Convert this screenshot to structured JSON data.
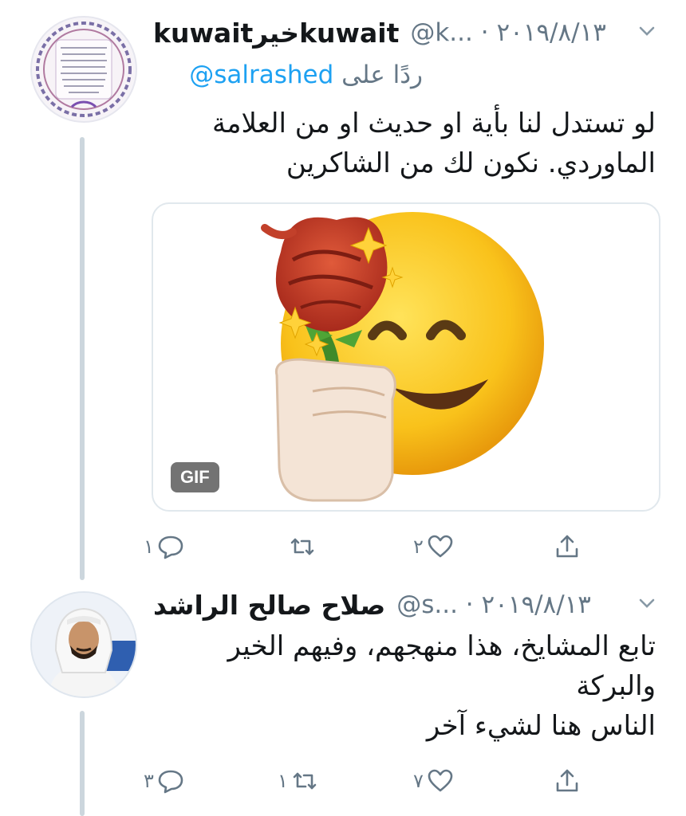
{
  "tweet1": {
    "author_name": "kuwaitخيرkuwait",
    "meta": "@k... · ٢٠١٩/٨/١٣",
    "reply_to_label": "ردًا على",
    "reply_to_handle": "@salrashed",
    "text_lines": [
      "لو تستدل لنا بأية او حديث او من العلامة",
      "الماوردي. نكون لك من الشاكرين"
    ],
    "media_badge": "GIF",
    "actions": {
      "reply_count": "١",
      "retweet_count": "",
      "like_count": "٢"
    }
  },
  "tweet2": {
    "author_name": "صلاح صالح الراشد",
    "meta": "@s... · ٢٠١٩/٨/١٣",
    "text_lines": [
      "تابع المشايخ، هذا منهجهم، وفيهم الخير",
      "والبركة",
      "الناس هنا لشيء آخر"
    ],
    "actions": {
      "reply_count": "٣",
      "retweet_count": "١",
      "like_count": "٧"
    }
  },
  "icons": {
    "reply": "speech-bubble-icon",
    "retweet": "retweet-arrows-icon",
    "like": "heart-icon",
    "share": "share-upload-icon",
    "caret": "chevron-down-icon"
  },
  "colors": {
    "text": "#14171a",
    "secondary": "#657786",
    "link": "#1da1f2",
    "line": "#ccd6dd",
    "border": "#e1e8ed"
  }
}
